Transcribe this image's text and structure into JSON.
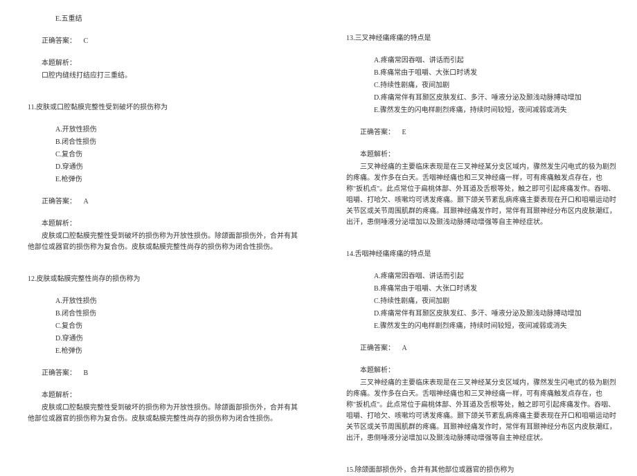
{
  "left": {
    "q10_optE": "E.五重结",
    "q10_answer_label": "正确答案：",
    "q10_answer": "C",
    "q10_explain_label": "本题解析：",
    "q10_explain": "口腔内缝线打结应打三重结。",
    "q11_title": "11.皮肤或口腔黏膜完整性受到破坏的损伤称为",
    "q11_optA": "A.开放性损伤",
    "q11_optB": "B.闭合性损伤",
    "q11_optC": "C.复合伤",
    "q11_optD": "D.穿通伤",
    "q11_optE": "E.枪弹伤",
    "q11_answer_label": "正确答案：",
    "q11_answer": "A",
    "q11_explain_label": "本题解析：",
    "q11_explain": "皮肤或口腔黏膜完整性受到破坏的损伤称为开放性损伤。除颌面部损伤外，合并有其他部位或器官的损伤称为复合伤。皮肤或黏膜完整性尚存的损伤称为闭合性损伤。",
    "q12_title": "12.皮肤或黏膜完整性尚存的损伤称为",
    "q12_optA": "A.开放性损伤",
    "q12_optB": "B.闭合性损伤",
    "q12_optC": "C.复合伤",
    "q12_optD": "D.穿通伤",
    "q12_optE": "E.枪弹伤",
    "q12_answer_label": "正确答案：",
    "q12_answer": "B",
    "q12_explain_label": "本题解析：",
    "q12_explain": "皮肤或口腔黏膜完整性受到破坏的损伤称为开放性损伤。除颌面部损伤外，合并有其他部位或器官的损伤称为复合伤。皮肤或黏膜完整性尚存的损伤称为闭合性损伤。"
  },
  "right": {
    "q13_title": "13.三叉神经痛疼痛的特点是",
    "q13_optA": "A.疼痛常因吞咽、讲话而引起",
    "q13_optB": "B.疼痛常由于咀嚼、大张口时诱发",
    "q13_optC": "C.持续性剧痛，夜间加剧",
    "q13_optD": "D.疼痛常伴有耳颞区皮肤发红、多汗、唾液分泌及颞浅动脉搏动增加",
    "q13_optE": "E.骤然发生的闪电样剧烈疼痛，持续时间较短，夜间减弱或消失",
    "q13_answer_label": "正确答案：",
    "q13_answer": "E",
    "q13_explain_label": "本题解析：",
    "q13_explain": "三叉神经痛的主要临床表现是在三叉神经某分支区域内，骤然发生闪电式的极为剧烈的疼痛。发作多在白天。舌咽神经痛也和三叉神经痛一样，可有疼痛触发点存在，也称\"扳机点\"。此点常位于扁桃体部、外耳道及舌根等处，触之即可引起疼痛发作。吞咽、咀嚼、打哈欠、咳嗽均可诱发疼痛。颞下颌关节紊乱病疼痛主要表现在开口和咀嚼运动时关节区或关节周围肌群的疼痛。耳颞神经痛发作时，常伴有耳颞神经分布区内皮肤潮红，出汗，患侧唾液分泌增加以及颞浅动脉搏动增强等自主神经症状。",
    "q14_title": "14.舌咽神经痛疼痛的特点是",
    "q14_optA": "A.疼痛常因吞咽、讲话而引起",
    "q14_optB": "B.疼痛常由于咀嚼、大张口时诱发",
    "q14_optC": "C.持续性剧痛，夜间加剧",
    "q14_optD": "D.疼痛常伴有耳颞区皮肤发红、多汗、唾液分泌及颞浅动脉搏动增加",
    "q14_optE": "E.骤然发生的闪电样剧烈疼痛，持续时间较短，夜间减弱或消失",
    "q14_answer_label": "正确答案：",
    "q14_answer": "A",
    "q14_explain_label": "本题解析：",
    "q14_explain": "三叉神经痛的主要临床表现是在三叉神经某分支区域内，骤然发生闪电式的极为剧烈的疼痛。发作多在白天。舌咽神经痛也和三叉神经痛一样，可有疼痛触发点存在，也称\"扳机点\"。此点常位于扁桃体部、外耳道及舌根等处，触之即可引起疼痛发作。吞咽、咀嚼、打哈欠、咳嗽均可诱发疼痛。颞下颌关节紊乱病疼痛主要表现在开口和咀嚼运动时关节区或关节周围肌群的疼痛。耳颞神经痛发作时，常伴有耳颞神经分布区内皮肤潮红，出汗，患侧唾液分泌增加以及颞浅动脉搏动增强等自主神经症状。",
    "q15_title": "15.除颌面部损伤外，合并有其他部位或器官的损伤称为"
  }
}
